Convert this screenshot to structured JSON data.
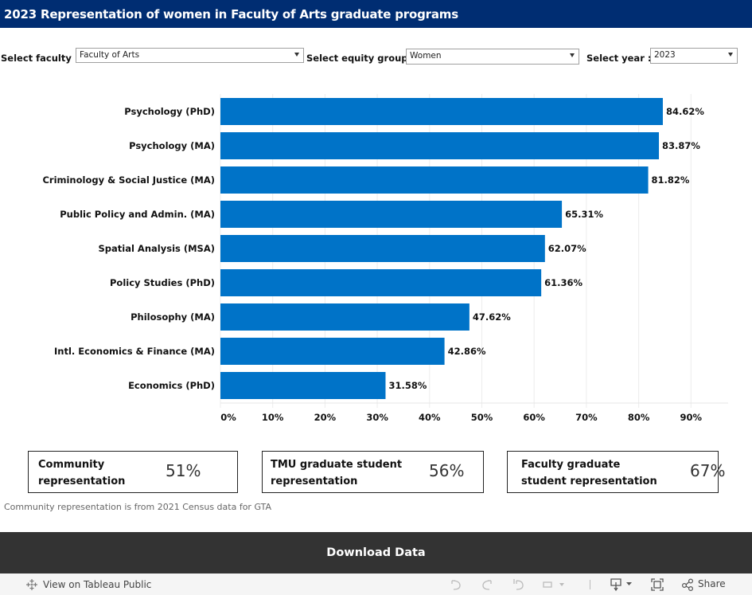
{
  "header": {
    "title": "2023 Representation of women in Faculty of Arts graduate programs"
  },
  "filters": {
    "faculty": {
      "label": "Select faculty :",
      "value": "Faculty of Arts"
    },
    "equity_group": {
      "label": "Select equity group :",
      "value": "Women"
    },
    "year": {
      "label": "Select year :",
      "value": "2023"
    }
  },
  "chart_data": {
    "type": "bar",
    "orientation": "horizontal",
    "title": "",
    "xlabel": "",
    "ylabel": "",
    "categories": [
      "Psychology (PhD)",
      "Psychology (MA)",
      "Criminology & Social Justice (MA)",
      "Public Policy and Admin. (MA)",
      "Spatial Analysis (MSA)",
      "Policy Studies (PhD)",
      "Philosophy (MA)",
      "Intl. Economics & Finance (MA)",
      "Economics (PhD)"
    ],
    "values": [
      84.62,
      83.87,
      81.82,
      65.31,
      62.07,
      61.36,
      47.62,
      42.86,
      31.58
    ],
    "value_labels": [
      "84.62%",
      "83.87%",
      "81.82%",
      "65.31%",
      "62.07%",
      "61.36%",
      "47.62%",
      "42.86%",
      "31.58%"
    ],
    "xlim": [
      0,
      97
    ],
    "xticks": [
      0,
      10,
      20,
      30,
      40,
      50,
      60,
      70,
      80,
      90
    ],
    "xtick_labels": [
      "0%",
      "10%",
      "20%",
      "30%",
      "40%",
      "50%",
      "60%",
      "70%",
      "80%",
      "90%"
    ],
    "grid": true,
    "legend": "none",
    "bar_color": "#0073c8"
  },
  "kpis": [
    {
      "label_line1": "Community",
      "label_line2": "representation",
      "value": "51%"
    },
    {
      "label_line1": "TMU graduate student",
      "label_line2": "representation",
      "value": "56%"
    },
    {
      "label_line1": "Faculty graduate",
      "label_line2": "student representation",
      "value": "67%"
    }
  ],
  "note": "Community representation is from 2021 Census data for GTA",
  "download": {
    "label": "Download Data"
  },
  "footer": {
    "view_on_label": "View on Tableau Public",
    "share_label": "Share",
    "icons": [
      "undo-icon",
      "redo-icon",
      "revert-icon",
      "refresh-icon",
      "download-icon",
      "fullscreen-icon",
      "share-icon"
    ]
  }
}
